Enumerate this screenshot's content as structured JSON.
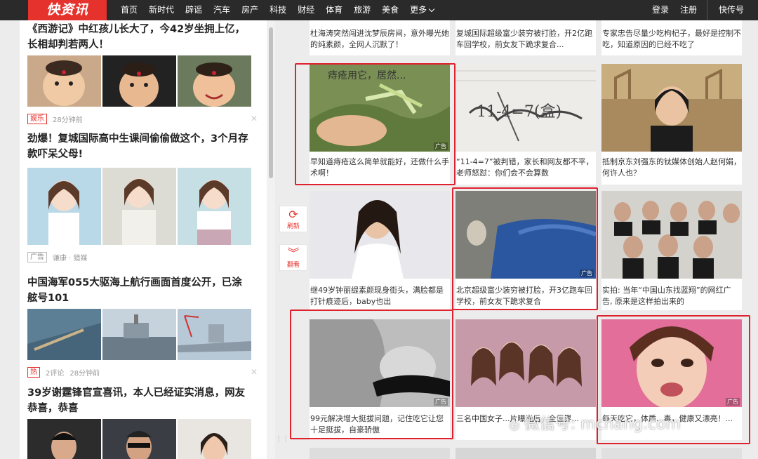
{
  "brand": {
    "logo": "快资讯",
    "accent": "#e5322d"
  },
  "nav": {
    "items": [
      "首页",
      "新时代",
      "辟谣",
      "汽车",
      "房产",
      "科技",
      "财经",
      "体育",
      "旅游",
      "美食"
    ],
    "more": "更多"
  },
  "user_links": {
    "login": "登录",
    "register": "注册",
    "kuaichuanhao": "快传号"
  },
  "left_feed": [
    {
      "title": "《西游记》中红孩儿长大了，今42岁坐拥上亿，长相却判若两人！",
      "tag": "娱乐",
      "meta": [
        "28分钟前"
      ]
    },
    {
      "title": "劲爆！复城国际高中生课间偷偷做这个，3个月存款吓呆父母!",
      "tag": "广告",
      "meta": [
        "谦康 · 猎媒"
      ]
    },
    {
      "title": "中国海军055大驱海上航行画面首度公开，已涂舷号101",
      "tag": "热",
      "meta": [
        "2评论",
        "28分钟前"
      ]
    },
    {
      "title": "39岁谢霆锋官宣喜讯，本人已经证实消息，网友恭喜，恭喜",
      "tag": "",
      "meta": []
    }
  ],
  "float_buttons": {
    "refresh": "刷新",
    "flip": "翻看"
  },
  "grid": {
    "top_captions": [
      "杜海涛突然闯进沈梦辰房间，意外曝光她的纯素颜，全网人沉默了！",
      "复城国际超级富少装穷被打脸，开2亿跑车回学校，前女友下跪求复合...",
      "专家忠告尽量少吃枸杞子，最好是控制不吃，知道原因的已经不吃了"
    ],
    "cards": [
      {
        "caption": "早知道痔疮这么简单就能好，还做什么手术啊！",
        "ad": "广告",
        "overlay": "痔疮用它，居然..."
      },
      {
        "caption": "“11-4=7”被判错，家长和网友都不平，老师怒怼：你们会不会算数",
        "ad": "",
        "overlay": "11-4=7(盒)"
      },
      {
        "caption": "抵制京东刘强东的钛媒体创始人赵何娟，何许人也？",
        "ad": "",
        "overlay": ""
      },
      {
        "caption": "继49岁钟丽缇素颜现身街头，满脸都是打针痕迹后，baby也出",
        "ad": "",
        "overlay": ""
      },
      {
        "caption": "北京超级富少装穷被打脸，开3亿跑车回学校，前女友下跪求复合",
        "ad": "广告",
        "overlay": ""
      },
      {
        "caption": "实拍: 当年“中国山东找蓝翔”的网红广告, 原来是这样拍出来的",
        "ad": "",
        "overlay": ""
      },
      {
        "caption": "99元解决增大挺拔问题，记住吃它让您十足挺拔，自豪骄傲",
        "ad": "广告",
        "overlay": ""
      },
      {
        "caption": "三名中国女子...片曝光后，全世界...",
        "ad": "",
        "overlay": ""
      },
      {
        "caption": "每天吃它，体质...毒，健康又漂亮！...",
        "ad": "广告",
        "overlay": ""
      }
    ]
  },
  "watermark": "微信号: mchang.com"
}
